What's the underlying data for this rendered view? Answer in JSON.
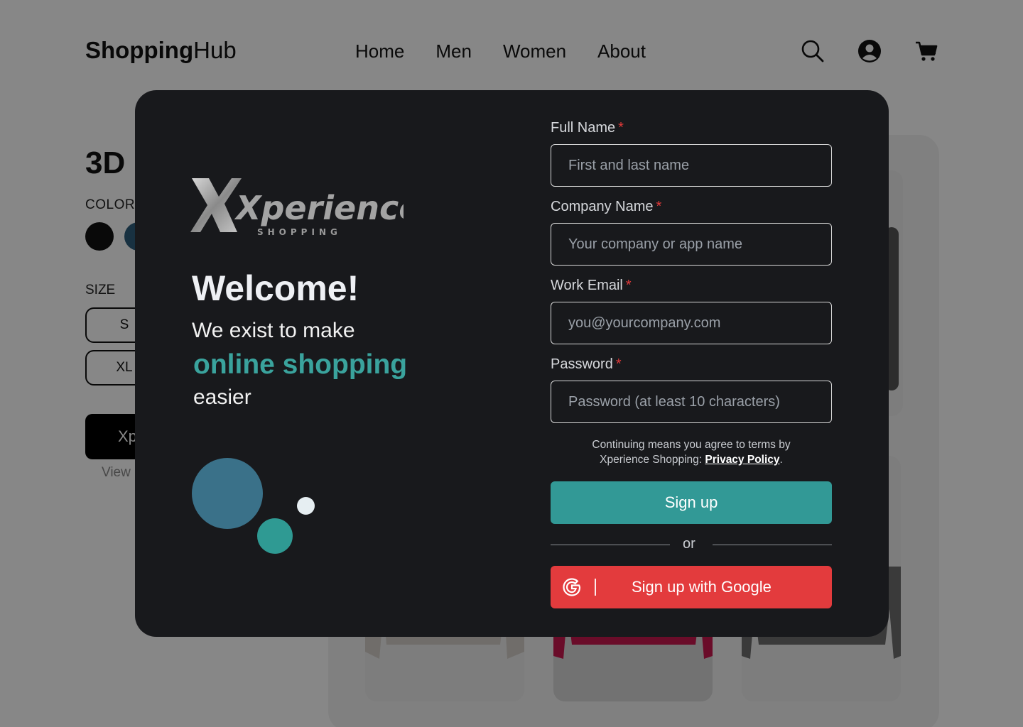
{
  "header": {
    "logo_bold": "Shopping",
    "logo_light": "Hub",
    "nav": [
      "Home",
      "Men",
      "Women",
      "About"
    ],
    "icons": [
      "search-icon",
      "user-account-icon",
      "cart-icon"
    ]
  },
  "product": {
    "title": "3D",
    "color_label": "COLOR",
    "colors": [
      "#111111",
      "#2f5d7c"
    ],
    "size_label": "SIZE",
    "sizes": [
      "S",
      "XL"
    ],
    "add_button_label": "Xp",
    "view_link": "View"
  },
  "modal": {
    "brand": {
      "name": "Xperience",
      "sub": "SHOPPING"
    },
    "welcome": "Welcome!",
    "tagline_1": "We exist to make",
    "tagline_highlight": "online shopping",
    "tagline_2": "easier",
    "form": {
      "full_name": {
        "label": "Full Name",
        "required": "*",
        "placeholder": "First and last name",
        "value": ""
      },
      "company_name": {
        "label": "Company Name",
        "required": "*",
        "placeholder": "Your company or app name",
        "value": ""
      },
      "work_email": {
        "label": "Work Email",
        "required": "*",
        "placeholder": "you@yourcompany.com",
        "value": ""
      },
      "password": {
        "label": "Password",
        "required": "*",
        "placeholder": "Password (at least 10 characters)",
        "value": ""
      },
      "terms_line1": "Continuing means you agree to terms by",
      "terms_line2": "Xperience Shopping:",
      "privacy_link": "Privacy Policy",
      "terms_end": ".",
      "signup_label": "Sign up",
      "or_label": "or",
      "google_label": "Sign up with Google"
    }
  },
  "colors": {
    "accent_teal": "#329996",
    "highlight_teal": "#3aa39d",
    "google_red": "#e33b3d",
    "modal_bg": "#18191c",
    "circle_blue": "#3a7189",
    "circle_teal": "#2f9a93",
    "circle_light": "#e6eef2"
  }
}
